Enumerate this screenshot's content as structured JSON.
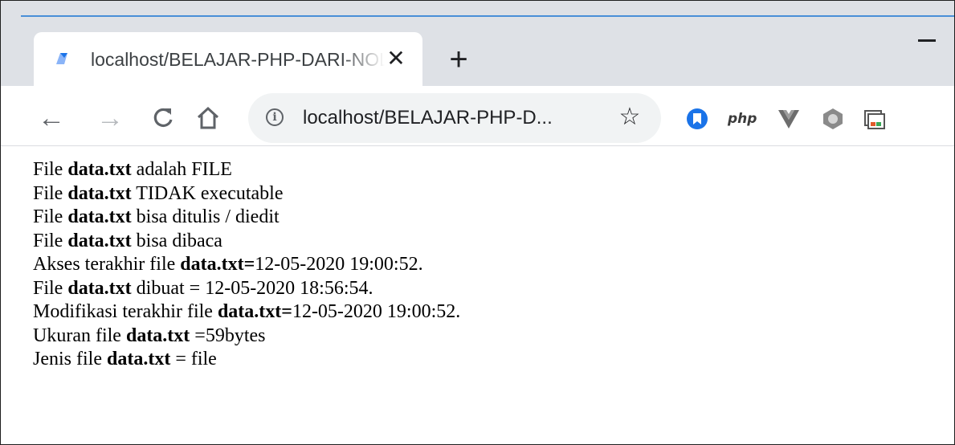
{
  "tab": {
    "title": "localhost/BELAJAR-PHP-DARI-NOL/",
    "close_icon": "close-icon",
    "favicon_icon": "localhost-favicon-icon"
  },
  "toolbar": {
    "url": "localhost/BELAJAR-PHP-D...",
    "icons": [
      "back-arrow-icon",
      "forward-arrow-icon",
      "reload-icon",
      "home-icon",
      "info-icon",
      "star-icon"
    ]
  },
  "extensions": {
    "php_label": "php",
    "icons": [
      "blue-bookmark-extension-icon",
      "php-extension-icon",
      "vue-extension-icon",
      "gray-hexagon-extension-icon",
      "window-extension-icon"
    ]
  },
  "colors": {
    "accent": "#1a73e8",
    "titlebar": "#dee1e6",
    "vue_dark": "#35495e"
  },
  "lines": [
    [
      {
        "t": "File ",
        "b": false
      },
      {
        "t": "data.txt",
        "b": true
      },
      {
        "t": " adalah FILE",
        "b": false
      }
    ],
    [
      {
        "t": "File ",
        "b": false
      },
      {
        "t": "data.txt",
        "b": true
      },
      {
        "t": " TIDAK executable",
        "b": false
      }
    ],
    [
      {
        "t": "File ",
        "b": false
      },
      {
        "t": "data.txt",
        "b": true
      },
      {
        "t": " bisa ditulis / diedit",
        "b": false
      }
    ],
    [
      {
        "t": "File ",
        "b": false
      },
      {
        "t": "data.txt",
        "b": true
      },
      {
        "t": " bisa dibaca",
        "b": false
      }
    ],
    [
      {
        "t": "Akses terakhir file ",
        "b": false
      },
      {
        "t": "data.txt=",
        "b": true
      },
      {
        "t": "12-05-2020 19:00:52.",
        "b": false
      }
    ],
    [
      {
        "t": "File ",
        "b": false
      },
      {
        "t": "data.txt",
        "b": true
      },
      {
        "t": " dibuat = 12-05-2020 18:56:54.",
        "b": false
      }
    ],
    [
      {
        "t": "Modifikasi terakhir file ",
        "b": false
      },
      {
        "t": "data.txt=",
        "b": true
      },
      {
        "t": "12-05-2020 19:00:52.",
        "b": false
      }
    ],
    [
      {
        "t": "Ukuran file ",
        "b": false
      },
      {
        "t": "data.txt",
        "b": true
      },
      {
        "t": " =59bytes",
        "b": false
      }
    ],
    [
      {
        "t": "Jenis file ",
        "b": false
      },
      {
        "t": "data.txt",
        "b": true
      },
      {
        "t": " = file",
        "b": false
      }
    ]
  ]
}
